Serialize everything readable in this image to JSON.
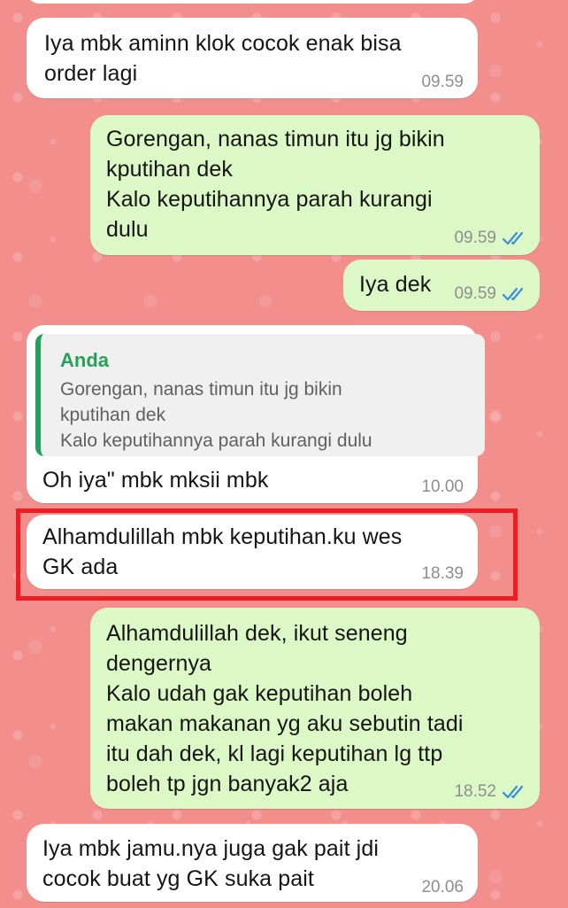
{
  "chat": {
    "messages": [
      {
        "direction": "in",
        "text": "Iya mbk aminn klok cocok enak bisa\norder lagi",
        "time": "09.59"
      },
      {
        "direction": "out",
        "text": "Gorengan, nanas timun itu jg bikin\nkputihan dek\nKalo keputihannya parah kurangi\ndulu",
        "time": "09.59",
        "status": "read"
      },
      {
        "direction": "out",
        "text": "Iya dek",
        "time": "09.59",
        "status": "read"
      },
      {
        "direction": "in",
        "quote": {
          "author": "Anda",
          "text": "Gorengan, nanas timun itu jg bikin\nkputihan dek\nKalo keputihannya parah kurangi dulu"
        },
        "text": "Oh iya\" mbk mksii mbk",
        "time": "10.00"
      },
      {
        "direction": "in",
        "text": "Alhamdulillah mbk keputihan.ku wes\nGK ada",
        "time": "18.39",
        "highlighted": true
      },
      {
        "direction": "out",
        "text": "Alhamdulillah dek, ikut seneng\ndengernya\nKalo udah gak keputihan boleh\nmakan makanan yg aku sebutin tadi\nitu dah dek, kl lagi keputihan lg ttp\nboleh tp jgn banyak2 aja",
        "time": "18.52",
        "status": "read"
      },
      {
        "direction": "in",
        "text": "Iya mbk jamu.nya juga gak pait jdi\ncocok buat yg GK suka pait",
        "time": "20.06"
      }
    ]
  },
  "colors": {
    "wallpaper": "#f28f8d",
    "incoming_bubble": "#ffffff",
    "outgoing_bubble": "#dcf8c6",
    "read_ticks": "#3a8dde",
    "quote_accent": "#25a05b",
    "highlight_box": "#ef1c24"
  },
  "icons": {
    "read_status": "double-check-icon"
  }
}
